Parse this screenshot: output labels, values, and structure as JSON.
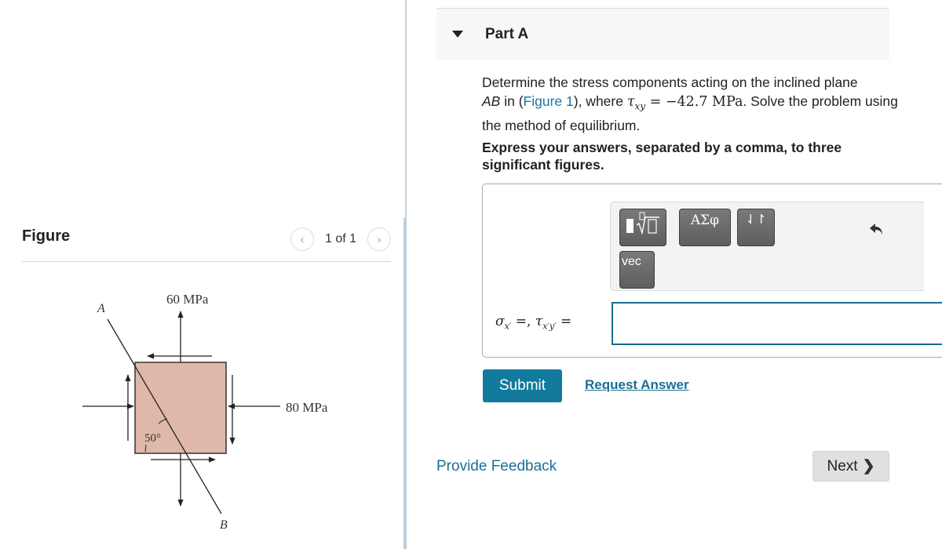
{
  "figure_panel": {
    "title": "Figure",
    "pager": {
      "prev_icon": "chevron-left",
      "text": "1 of 1",
      "next_icon": "chevron-right"
    },
    "diagram": {
      "point_a": "A",
      "point_b": "B",
      "vertical_stress_label": "60 MPa",
      "horizontal_stress_label": "80 MPa",
      "angle_label": "50°",
      "element_fill": "#dfb8aa"
    }
  },
  "part": {
    "title": "Part A",
    "caret_icon": "caret-down",
    "question": {
      "text_1": "Determine the stress components acting on the inclined plane ",
      "plane": "AB",
      "text_2": " in (",
      "figure_link": "Figure 1",
      "text_3": "), where ",
      "tau_symbol": "τ",
      "tau_sub": "xy",
      "equals_value": " = −42.7 ",
      "unit": "MPa",
      "text_4": ". Solve the problem using the method of equilibrium."
    },
    "instruction": "Express your answers, separated by a comma, to three significant figures.",
    "toolbar": {
      "templates_icon": "templates-radical",
      "greek_label": "ΑΣφ",
      "arrows_label": "⇃↾",
      "vec_label": "vec",
      "undo_icon": "undo"
    },
    "answer_label": {
      "sigma": "σ",
      "sigma_sub": "x′",
      "middle": " =,  ",
      "tau": "τ",
      "tau_sub": "x′y′",
      "end": " ="
    },
    "answer_value": "",
    "submit_label": "Submit",
    "request_answer_label": "Request Answer"
  },
  "footer": {
    "feedback_label": "Provide Feedback",
    "next_label": "Next",
    "next_icon": "❯"
  },
  "colors": {
    "accent": "#127a9c",
    "link": "#1a6f96",
    "input_border": "#1b6a8f"
  }
}
